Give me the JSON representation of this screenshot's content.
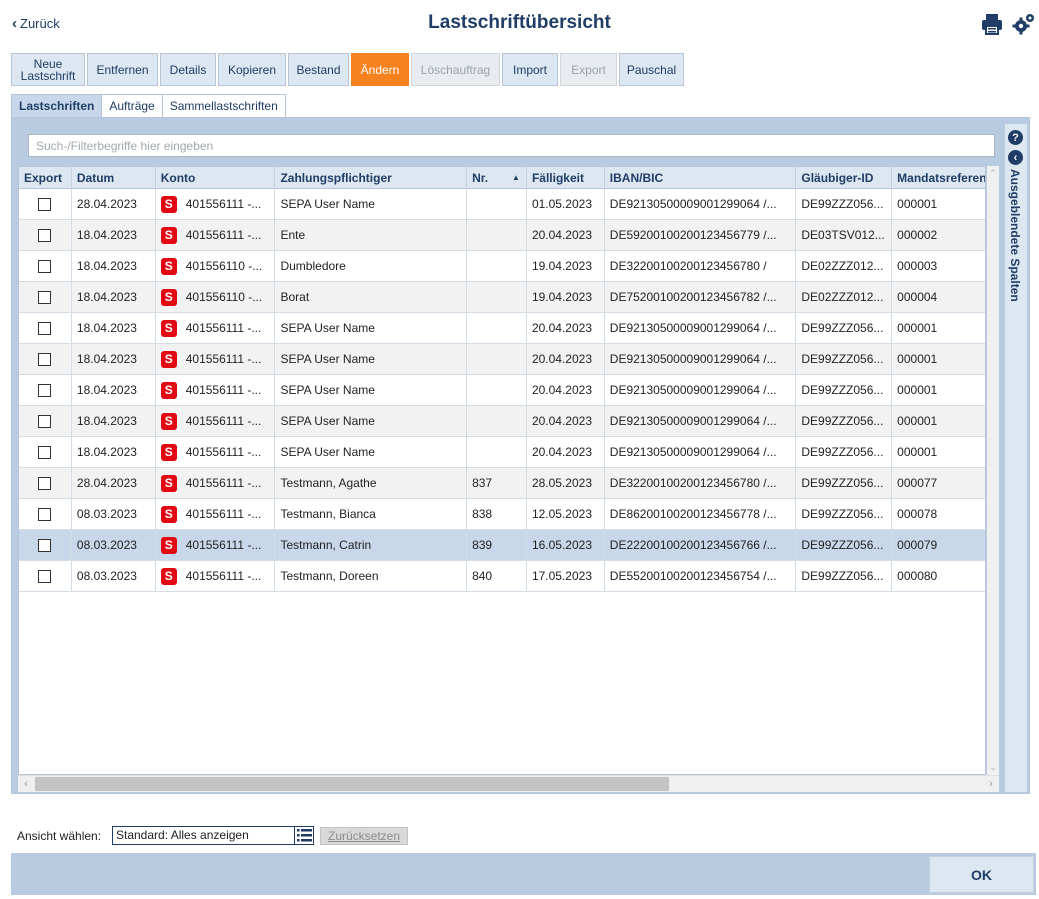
{
  "header": {
    "back_label": "Zurück",
    "title": "Lastschriftübersicht",
    "icons": [
      "print-icon",
      "gear-icon"
    ]
  },
  "toolbar": [
    {
      "line1": "Neue",
      "line2": "Lastschrift",
      "state": "normal"
    },
    {
      "line1": "Entfernen",
      "line2": "",
      "state": "normal"
    },
    {
      "line1": "Details",
      "line2": "",
      "state": "normal"
    },
    {
      "line1": "Kopieren",
      "line2": "",
      "state": "normal"
    },
    {
      "line1": "Bestand",
      "line2": "",
      "state": "normal"
    },
    {
      "line1": "Ändern",
      "line2": "",
      "state": "active"
    },
    {
      "line1": "Löschauftrag",
      "line2": "",
      "state": "disabled"
    },
    {
      "line1": "Import",
      "line2": "",
      "state": "normal"
    },
    {
      "line1": "Export",
      "line2": "",
      "state": "disabled"
    },
    {
      "line1": "Pauschal",
      "line2": "",
      "state": "normal"
    }
  ],
  "tabs": [
    {
      "label": "Lastschriften",
      "active": true
    },
    {
      "label": "Aufträge",
      "active": false
    },
    {
      "label": "Sammellastschriften",
      "active": false
    }
  ],
  "search": {
    "placeholder": "Such-/Filterbegriffe hier eingeben",
    "value": ""
  },
  "columns": [
    "Export",
    "Datum",
    "Konto",
    "Zahlungspflichtiger",
    "Nr.",
    "Fälligkeit",
    "IBAN/BIC",
    "Gläubiger-ID",
    "Mandatsreferenz"
  ],
  "sorted_column": "Nr.",
  "rows": [
    {
      "datum": "28.04.2023",
      "konto": "401556111 -...",
      "zahler": "SEPA User Name",
      "nr": "",
      "faelligkeit": "01.05.2023",
      "iban": "DE92130500009001299064 /...",
      "glaeubiger": "DE99ZZZ056...",
      "mandat": "000001",
      "checked": false
    },
    {
      "datum": "18.04.2023",
      "konto": "401556111 -...",
      "zahler": "Ente",
      "nr": "",
      "faelligkeit": "20.04.2023",
      "iban": "DE59200100200123456779 /...",
      "glaeubiger": "DE03TSV012...",
      "mandat": "000002",
      "checked": false
    },
    {
      "datum": "18.04.2023",
      "konto": "401556110 -...",
      "zahler": "Dumbledore",
      "nr": "",
      "faelligkeit": "19.04.2023",
      "iban": "DE32200100200123456780 /",
      "glaeubiger": "DE02ZZZ012...",
      "mandat": "000003",
      "checked": false
    },
    {
      "datum": "18.04.2023",
      "konto": "401556110 -...",
      "zahler": "Borat",
      "nr": "",
      "faelligkeit": "19.04.2023",
      "iban": "DE75200100200123456782 /...",
      "glaeubiger": "DE02ZZZ012...",
      "mandat": "000004",
      "checked": false
    },
    {
      "datum": "18.04.2023",
      "konto": "401556111 -...",
      "zahler": "SEPA User Name",
      "nr": "",
      "faelligkeit": "20.04.2023",
      "iban": "DE92130500009001299064 /...",
      "glaeubiger": "DE99ZZZ056...",
      "mandat": "000001",
      "checked": false
    },
    {
      "datum": "18.04.2023",
      "konto": "401556111 -...",
      "zahler": "SEPA User Name",
      "nr": "",
      "faelligkeit": "20.04.2023",
      "iban": "DE92130500009001299064 /...",
      "glaeubiger": "DE99ZZZ056...",
      "mandat": "000001",
      "checked": false
    },
    {
      "datum": "18.04.2023",
      "konto": "401556111 -...",
      "zahler": "SEPA User Name",
      "nr": "",
      "faelligkeit": "20.04.2023",
      "iban": "DE92130500009001299064 /...",
      "glaeubiger": "DE99ZZZ056...",
      "mandat": "000001",
      "checked": false
    },
    {
      "datum": "18.04.2023",
      "konto": "401556111 -...",
      "zahler": "SEPA User Name",
      "nr": "",
      "faelligkeit": "20.04.2023",
      "iban": "DE92130500009001299064 /...",
      "glaeubiger": "DE99ZZZ056...",
      "mandat": "000001",
      "checked": false
    },
    {
      "datum": "18.04.2023",
      "konto": "401556111 -...",
      "zahler": "SEPA User Name",
      "nr": "",
      "faelligkeit": "20.04.2023",
      "iban": "DE92130500009001299064 /...",
      "glaeubiger": "DE99ZZZ056...",
      "mandat": "000001",
      "checked": false
    },
    {
      "datum": "28.04.2023",
      "konto": "401556111 -...",
      "zahler": "Testmann, Agathe",
      "nr": "837",
      "faelligkeit": "28.05.2023",
      "iban": "DE32200100200123456780 /...",
      "glaeubiger": "DE99ZZZ056...",
      "mandat": "000077",
      "checked": false
    },
    {
      "datum": "08.03.2023",
      "konto": "401556111 -...",
      "zahler": "Testmann, Bianca",
      "nr": "838",
      "faelligkeit": "12.05.2023",
      "iban": "DE86200100200123456778 /...",
      "glaeubiger": "DE99ZZZ056...",
      "mandat": "000078",
      "checked": false
    },
    {
      "datum": "08.03.2023",
      "konto": "401556111 -...",
      "zahler": "Testmann, Catrin",
      "nr": "839",
      "faelligkeit": "16.05.2023",
      "iban": "DE22200100200123456766 /...",
      "glaeubiger": "DE99ZZZ056...",
      "mandat": "000079",
      "checked": false,
      "selected": true
    },
    {
      "datum": "08.03.2023",
      "konto": "401556111 -...",
      "zahler": "Testmann, Doreen",
      "nr": "840",
      "faelligkeit": "17.05.2023",
      "iban": "DE55200100200123456754 /...",
      "glaeubiger": "DE99ZZZ056...",
      "mandat": "000080",
      "checked": false
    }
  ],
  "bank_logo_glyph": "S",
  "side_panel": {
    "help_glyph": "?",
    "collapse_glyph": "‹",
    "label": "Ausgeblendete Spalten"
  },
  "view": {
    "label": "Ansicht wählen:",
    "value": "Standard: Alles anzeigen",
    "reset_label": "Zurücksetzen"
  },
  "footer": {
    "ok_label": "OK"
  },
  "colors": {
    "accent": "#f5821f",
    "primary_text": "#1f3d66",
    "panel_bg": "#b8cbe0",
    "selected_row": "#c8d8ea",
    "sparkasse_red": "#e30613"
  }
}
